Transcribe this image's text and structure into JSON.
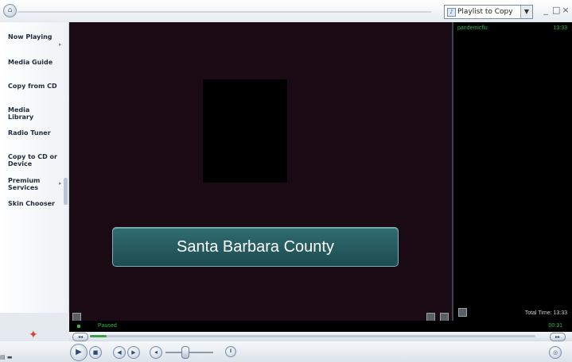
{
  "window": {
    "playlist_dropdown": "Playlist to Copy",
    "minimize": "_",
    "restore": "□",
    "close": "×"
  },
  "sidebar": {
    "items": [
      {
        "label": "Now Playing",
        "has_arrow": true
      },
      {
        "label": "Media Guide",
        "has_arrow": false
      },
      {
        "label": "Copy from CD",
        "has_arrow": false
      },
      {
        "label": "Media Library",
        "has_arrow": false
      },
      {
        "label": "Radio Tuner",
        "has_arrow": false
      },
      {
        "label": "Copy to CD or Device",
        "has_arrow": false
      },
      {
        "label": "Premium Services",
        "has_arrow": true
      },
      {
        "label": "Skin Chooser",
        "has_arrow": false
      }
    ]
  },
  "video": {
    "caption": "Santa Barbara County"
  },
  "playlist": {
    "track_name": "pandemicflu",
    "track_time": "13:33",
    "total_time": "Total Time: 13:33"
  },
  "status": {
    "state": "Paused",
    "elapsed": "00:31"
  },
  "seek": {
    "progress_fraction": 0.038
  },
  "colors": {
    "status_green": "#2fb34f",
    "video_bg": "#1a0a14",
    "caption_bg": "#2f6c70"
  },
  "icons": [
    "play-icon",
    "stop-icon",
    "previous-icon",
    "next-icon",
    "volume-icon",
    "equalizer-icon",
    "windows-logo-icon"
  ]
}
